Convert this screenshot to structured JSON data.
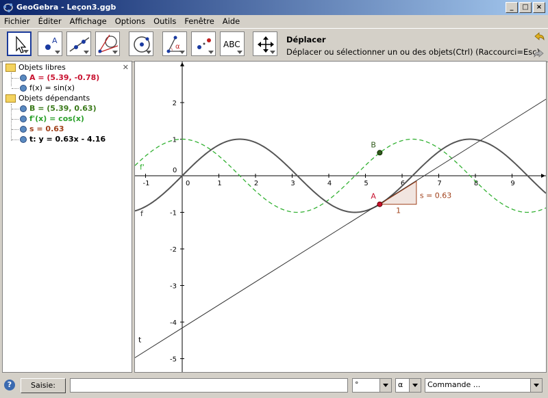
{
  "window": {
    "title": "GeoGebra - Leçon3.ggb"
  },
  "menu": [
    "Fichier",
    "Éditer",
    "Affichage",
    "Options",
    "Outils",
    "Fenêtre",
    "Aide"
  ],
  "toolbar": {
    "tool_name": "Déplacer",
    "tool_help": "Déplacer ou sélectionner un ou des objets(Ctrl) (Raccourci=Esc)",
    "text_tool_label": "ABC"
  },
  "algebra": {
    "free_header": "Objets libres",
    "free": [
      {
        "text": "A = (5.39, -0.78)",
        "color": "#c8102e",
        "bold": true
      },
      {
        "text": "f(x) = sin(x)",
        "color": "#000000",
        "bold": false
      }
    ],
    "dep_header": "Objets dépendants",
    "dependent": [
      {
        "text": "B = (5.39, 0.63)",
        "color": "#3a7a1a",
        "bold": true
      },
      {
        "text": "f'(x) = cos(x)",
        "color": "#2aa02a",
        "bold": true
      },
      {
        "text": "s = 0.63",
        "color": "#a0401a",
        "bold": true
      },
      {
        "text": "t: y = 0.63x - 4.16",
        "color": "#000000",
        "bold": true
      }
    ]
  },
  "graph": {
    "x_ticks": [
      "-1",
      "0",
      "1",
      "2",
      "3",
      "4",
      "5",
      "6",
      "7",
      "8",
      "9"
    ],
    "y_ticks": [
      "2",
      "1",
      "0",
      "-1",
      "-2",
      "-3",
      "-4",
      "-5"
    ],
    "labels": {
      "f": "f",
      "fprime": "f'",
      "t": "t",
      "A": "A",
      "B": "B",
      "slope": "s = 0.63",
      "run": "1"
    },
    "colors": {
      "f": "#555555",
      "fprime": "#30b030",
      "t": "#333333",
      "A": "#c8102e",
      "B": "#2f5a1a",
      "slope": "#a0401a"
    }
  },
  "inputbar": {
    "help": "?",
    "button_label": "Saisie:",
    "input_value": "",
    "degree_value": "°",
    "alpha_value": "α",
    "command_value": "Commande ..."
  },
  "chart_data": {
    "type": "line",
    "series": [
      {
        "name": "f",
        "expression": "sin(x)"
      },
      {
        "name": "f'",
        "expression": "cos(x)"
      },
      {
        "name": "t",
        "expression": "0.63x - 4.16"
      }
    ],
    "points": [
      {
        "name": "A",
        "x": 5.39,
        "y": -0.78
      },
      {
        "name": "B",
        "x": 5.39,
        "y": 0.63
      }
    ],
    "xlim": [
      -1.3,
      9.9
    ],
    "ylim": [
      -5.3,
      3.2
    ]
  }
}
